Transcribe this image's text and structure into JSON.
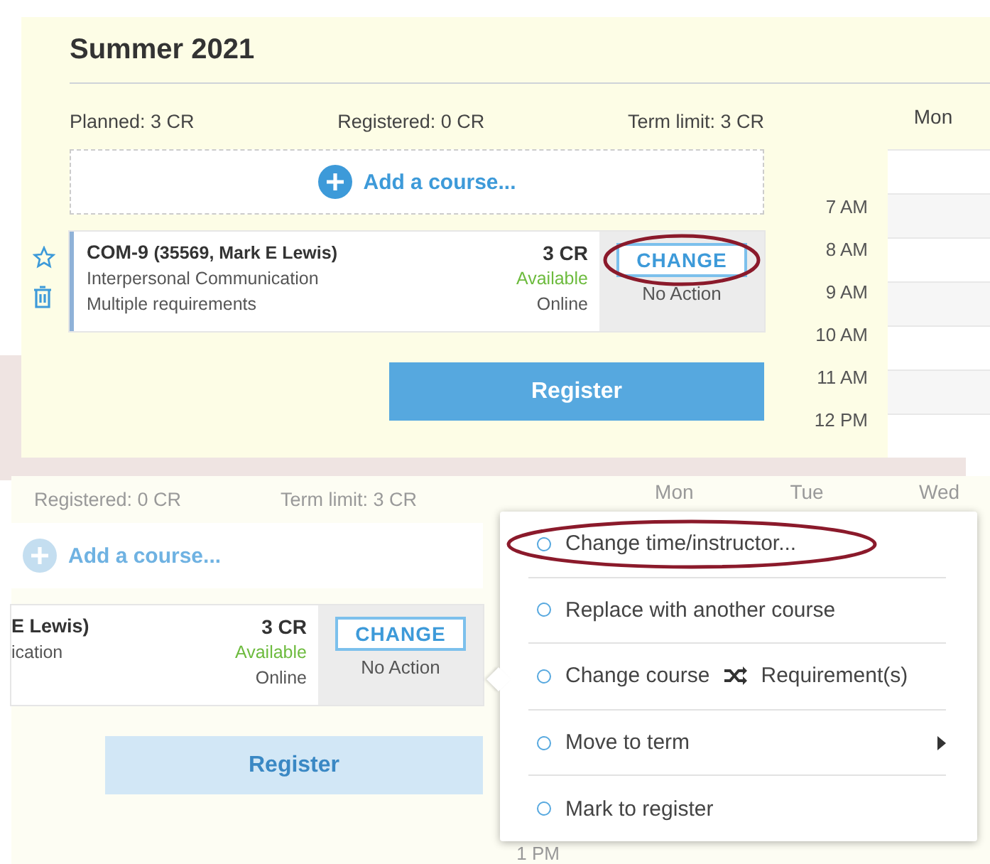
{
  "top_panel": {
    "term_title": "Summer 2021",
    "stats": [
      "Planned: 3 CR",
      "Registered: 0 CR",
      "Term limit: 3 CR"
    ],
    "add_course": "Add a course...",
    "course": {
      "code": "COM-9",
      "section": "(35569, Mark E Lewis)",
      "title": "Interpersonal Communication",
      "requirements": "Multiple requirements",
      "credits": "3 CR",
      "status": "Available",
      "mode": "Online",
      "action_button": "CHANGE",
      "action_status": "No Action",
      "action_button_circled": true
    },
    "register_button": {
      "label": "Register",
      "disabled": false
    },
    "calendar": {
      "day_headers": [
        "Mon"
      ],
      "times": [
        "7 AM",
        "8 AM",
        "9 AM",
        "10 AM",
        "11 AM",
        "12 PM"
      ]
    }
  },
  "bottom_panel": {
    "dimmed": true,
    "stats": [
      "Registered: 0 CR",
      "Term limit: 3 CR"
    ],
    "add_course": "Add a course...",
    "course": {
      "code_fragment": "E Lewis)",
      "title_fragment": "ication",
      "credits": "3 CR",
      "status": "Available",
      "mode": "Online",
      "action_button": "CHANGE",
      "action_status": "No Action"
    },
    "register_button": {
      "label": "Register",
      "disabled": true
    },
    "calendar": {
      "day_headers": [
        "Mon",
        "Tue",
        "Wed"
      ],
      "times": [
        "1 PM"
      ]
    },
    "menu": [
      {
        "kind": "option",
        "label": "Change time/instructor...",
        "circled": true
      },
      {
        "kind": "option",
        "label": "Replace with another course",
        "circled": false
      },
      {
        "kind": "shuffle",
        "label": "Change course",
        "suffix": "Requirement(s)",
        "circled": false
      },
      {
        "kind": "submenu",
        "label": "Move to term",
        "circled": false
      },
      {
        "kind": "option",
        "label": "Mark to register",
        "circled": false
      }
    ]
  }
}
